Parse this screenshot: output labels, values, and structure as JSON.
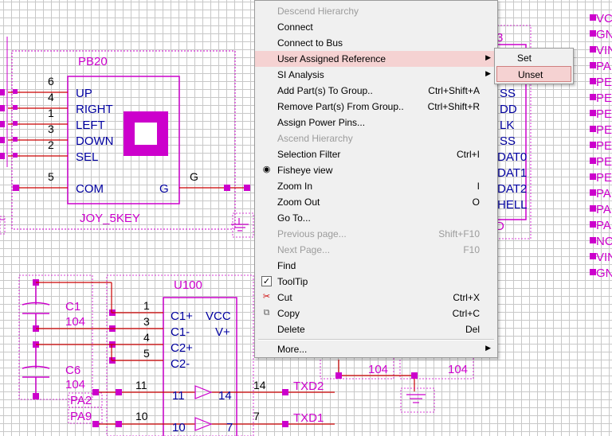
{
  "schematic": {
    "joy": {
      "designator": "PB20",
      "value": "JOY_5KEY",
      "pins": [
        "UP",
        "RIGHT",
        "LEFT",
        "DOWN",
        "SEL",
        "COM",
        "G"
      ],
      "pin_numbers": [
        "6",
        "4",
        "1",
        "3",
        "2",
        "5",
        "G"
      ]
    },
    "u100": {
      "designator": "U100",
      "pins_left": [
        "C1+",
        "C1-",
        "C2+",
        "C2-"
      ],
      "pins_right": [
        "VCC",
        "V+"
      ],
      "pin_numbers": [
        "1",
        "3",
        "4",
        "5"
      ],
      "buffer_pins": [
        "11",
        "14",
        "10",
        "7"
      ],
      "outer_numbers": [
        "11",
        "10",
        "14",
        "7"
      ]
    },
    "caps": [
      {
        "designator": "C1",
        "value": "104"
      },
      {
        "designator": "C6",
        "value": "104"
      }
    ],
    "bottom_values": [
      "104",
      "104"
    ],
    "nets": [
      "PA2",
      "PA9",
      "TXD2",
      "TXD1"
    ],
    "right_part": {
      "designator_fragment": "3",
      "pins": [
        "SS",
        "DD",
        "LK",
        "SS",
        "DAT0",
        "DAT1",
        "DAT2",
        "HELL"
      ],
      "bottom_fragment": "D"
    },
    "right_edge_labels": [
      "VC",
      "GN",
      "VIN",
      "PA",
      "PE",
      "PE",
      "PE",
      "PE",
      "PE",
      "PE",
      "PE",
      "PA",
      "PA",
      "PA",
      "NC",
      "VIN",
      "GN"
    ]
  },
  "menu": {
    "items": [
      {
        "label": "Descend Hierarchy",
        "shortcut": "",
        "disabled": true
      },
      {
        "label": "Connect",
        "shortcut": ""
      },
      {
        "label": "Connect to Bus",
        "shortcut": ""
      },
      {
        "label": "User Assigned Reference",
        "shortcut": "",
        "submenu": true,
        "highlighted": true
      },
      {
        "label": "SI Analysis",
        "shortcut": "",
        "submenu": true
      },
      {
        "label": "Add Part(s) To Group..",
        "shortcut": "Ctrl+Shift+A"
      },
      {
        "label": "Remove Part(s) From Group..",
        "shortcut": "Ctrl+Shift+R"
      },
      {
        "label": "Assign Power Pins...",
        "shortcut": ""
      },
      {
        "label": "Ascend Hierarchy",
        "shortcut": "",
        "disabled": true
      },
      {
        "label": "Selection Filter",
        "shortcut": "Ctrl+I"
      },
      {
        "label": "Fisheye view",
        "shortcut": "",
        "icon": "eye-icon"
      },
      {
        "label": "Zoom In",
        "shortcut": "I"
      },
      {
        "label": "Zoom Out",
        "shortcut": "O"
      },
      {
        "label": "Go To...",
        "shortcut": ""
      },
      {
        "label": "Previous page...",
        "shortcut": "Shift+F10",
        "disabled": true
      },
      {
        "label": "Next Page...",
        "shortcut": "F10",
        "disabled": true
      },
      {
        "label": "Find",
        "shortcut": ""
      },
      {
        "label": "ToolTip",
        "shortcut": "",
        "checked": true
      },
      {
        "label": "Cut",
        "shortcut": "Ctrl+X",
        "icon": "scissors-icon"
      },
      {
        "label": "Copy",
        "shortcut": "Ctrl+C",
        "icon": "copy-icon"
      },
      {
        "label": "Delete",
        "shortcut": "Del"
      },
      {
        "label": "More...",
        "shortcut": "",
        "submenu": true
      }
    ],
    "submenu_items": [
      "Set",
      "Unset"
    ],
    "submenu_highlighted": "Unset"
  },
  "colors": {
    "part": "#cc00cc",
    "wire": "#cc0000",
    "menu_highlight": "#f5d2d2"
  }
}
